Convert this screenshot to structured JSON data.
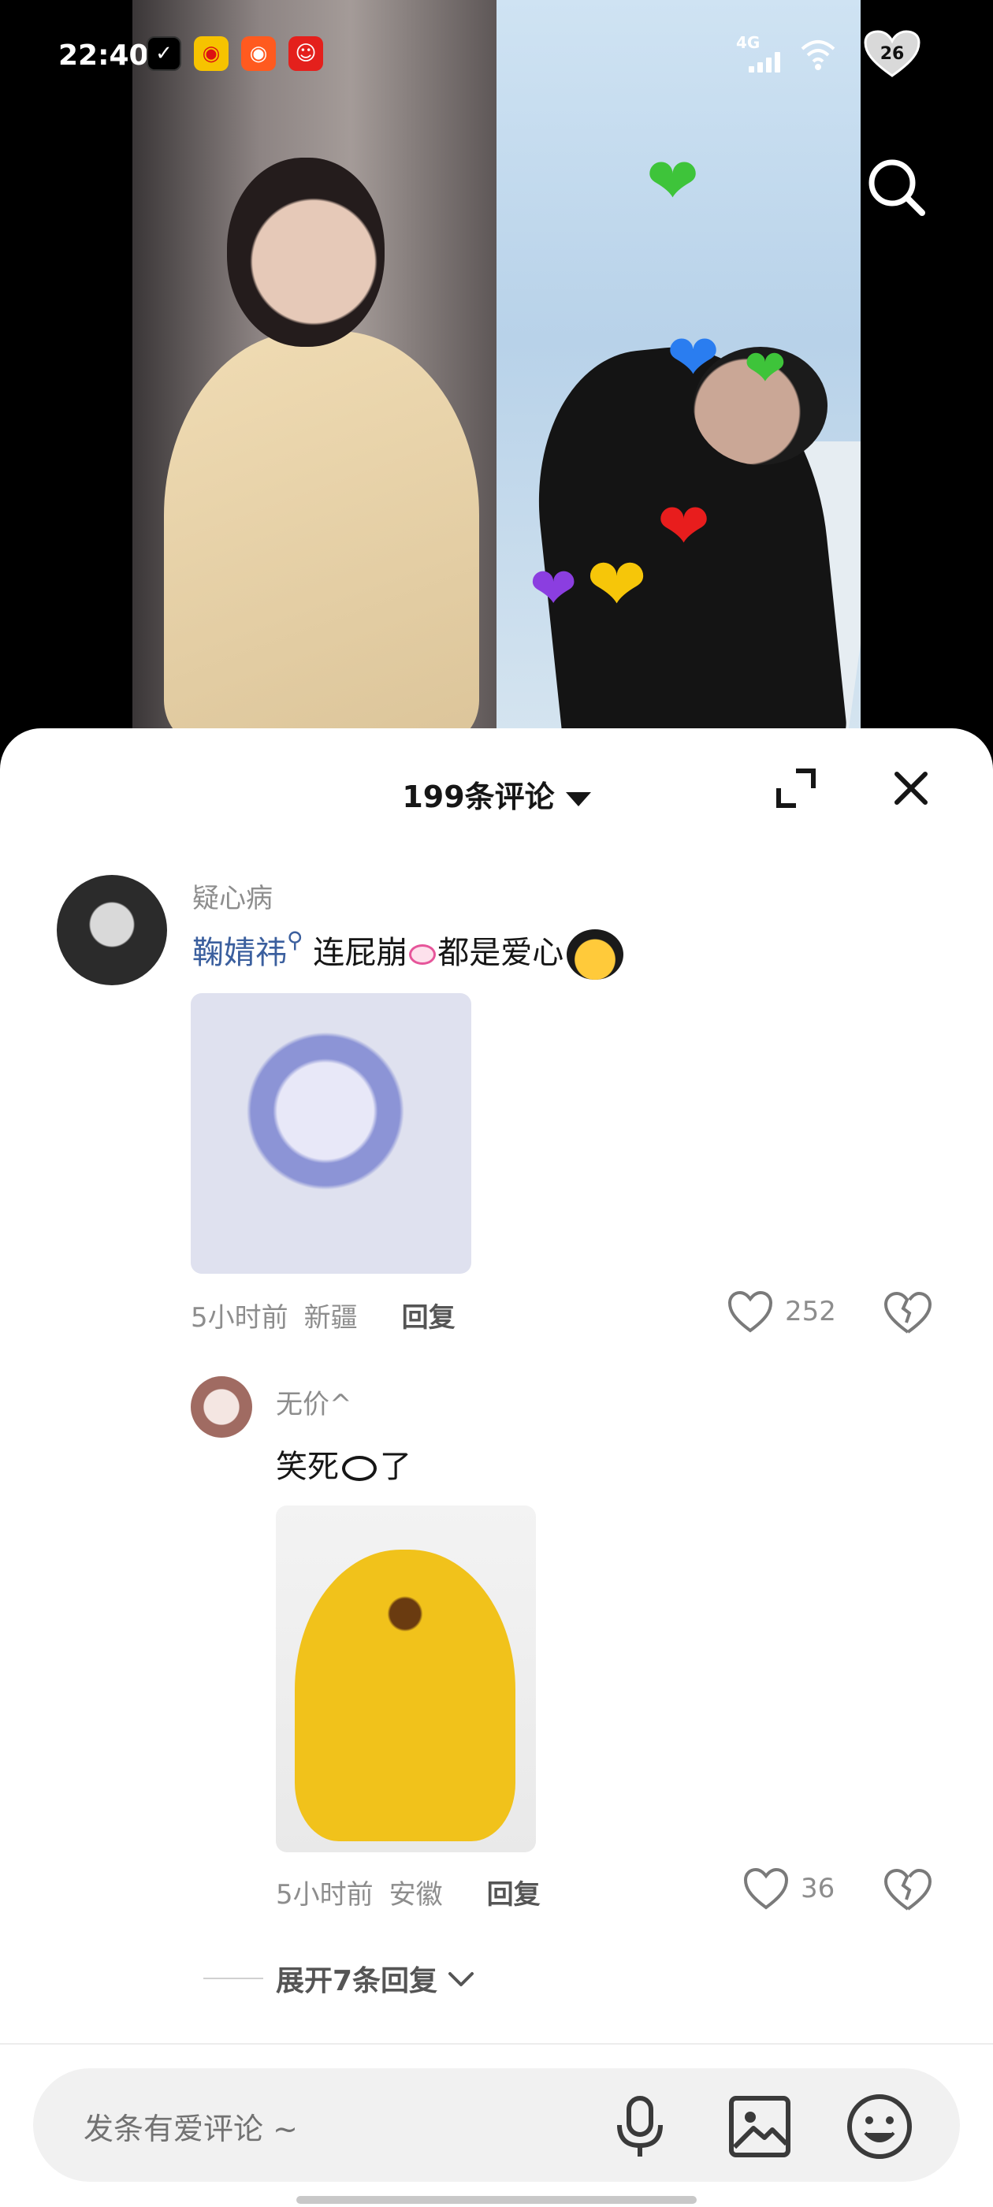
{
  "status_bar": {
    "time": "22:40",
    "network": "4G",
    "battery": "26",
    "app_icons": [
      "app-icon-black",
      "weibo-icon",
      "kuaishou-icon",
      "pinduoduo-icon"
    ]
  },
  "video": {
    "hearts": [
      "green-heart",
      "blue-heart",
      "green-heart",
      "red-heart",
      "purple-heart",
      "yellow-heart"
    ]
  },
  "sheet": {
    "title": "199条评论"
  },
  "comment": {
    "username": "疑心病",
    "mention": "鞠婧祎",
    "text": " 连屁崩",
    "text_after": "都是爱心",
    "time": "5小时前",
    "location": "新疆",
    "reply_label": "回复",
    "likes": "252"
  },
  "reply": {
    "username": "无价^",
    "text_before": "笑死",
    "text_after": "了",
    "time": "5小时前",
    "location": "安徽",
    "reply_label": "回复",
    "likes": "36"
  },
  "expand_replies": "展开7条回复",
  "input": {
    "placeholder": "发条有爱评论 ~"
  },
  "colors": {
    "mention": "#3b5f9e",
    "meta_gray": "#8d8d8d",
    "text": "#161616"
  }
}
